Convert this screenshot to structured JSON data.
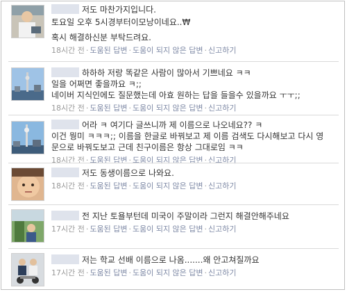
{
  "comments": [
    {
      "lines": [
        "저도 마찬가지입니다.",
        "토요일 오후 5시경부터이모낭이네요..₩",
        "혹시 해결하신분 부탁드려요."
      ],
      "time": "18시간 전",
      "avatar_icon": "avatar-person-photo"
    },
    {
      "lines": [
        "하하하 저랑 똑같은 사람이 많아서 기쁘네요 ㅋㅋ",
        "일을 어쩌면 좋을까요 ㅋ;;",
        "네이버 지식인에도 질문했는데 아효 원하는 답을 들을수 있을까요 ㅜㅜ;;"
      ],
      "time": "18시간 전",
      "avatar_icon": "avatar-tower-photo"
    },
    {
      "lines": [
        "어라 ㅋ 여기다 글쓰니까 제 이름으로 나오네요?? ㅋ",
        "이건 뭥미 ㅋㅋㅋ;; 이름을 한글로 바꿔보고 제 이름 검색도 다시해보고 다시 영",
        "문으로 바꿔도보고 근데 친구이름은 항상 그대로임 ㅋㅋ"
      ],
      "time": "18시간 전",
      "avatar_icon": "avatar-tower-photo"
    },
    {
      "lines": [
        "저도 동생이름으로 나와요."
      ],
      "time": "18시간 전",
      "avatar_icon": "avatar-face-photo"
    },
    {
      "lines": [
        "전 지난 토욜부턴데 미국이 주말이라 그런지 해결안해주네요"
      ],
      "time": "17시간 전",
      "avatar_icon": "avatar-garden-photo"
    },
    {
      "lines": [
        "저는 학교 선배 이름으로 나옴.......왜 안고쳐질까요"
      ],
      "time": "17시간 전",
      "avatar_icon": "avatar-motorcycle-photo"
    }
  ],
  "actions": {
    "helpful": "도움된 답변",
    "not_helpful": "도움이 되지 않은 답변",
    "report": "신고하기",
    "separator": "·"
  }
}
